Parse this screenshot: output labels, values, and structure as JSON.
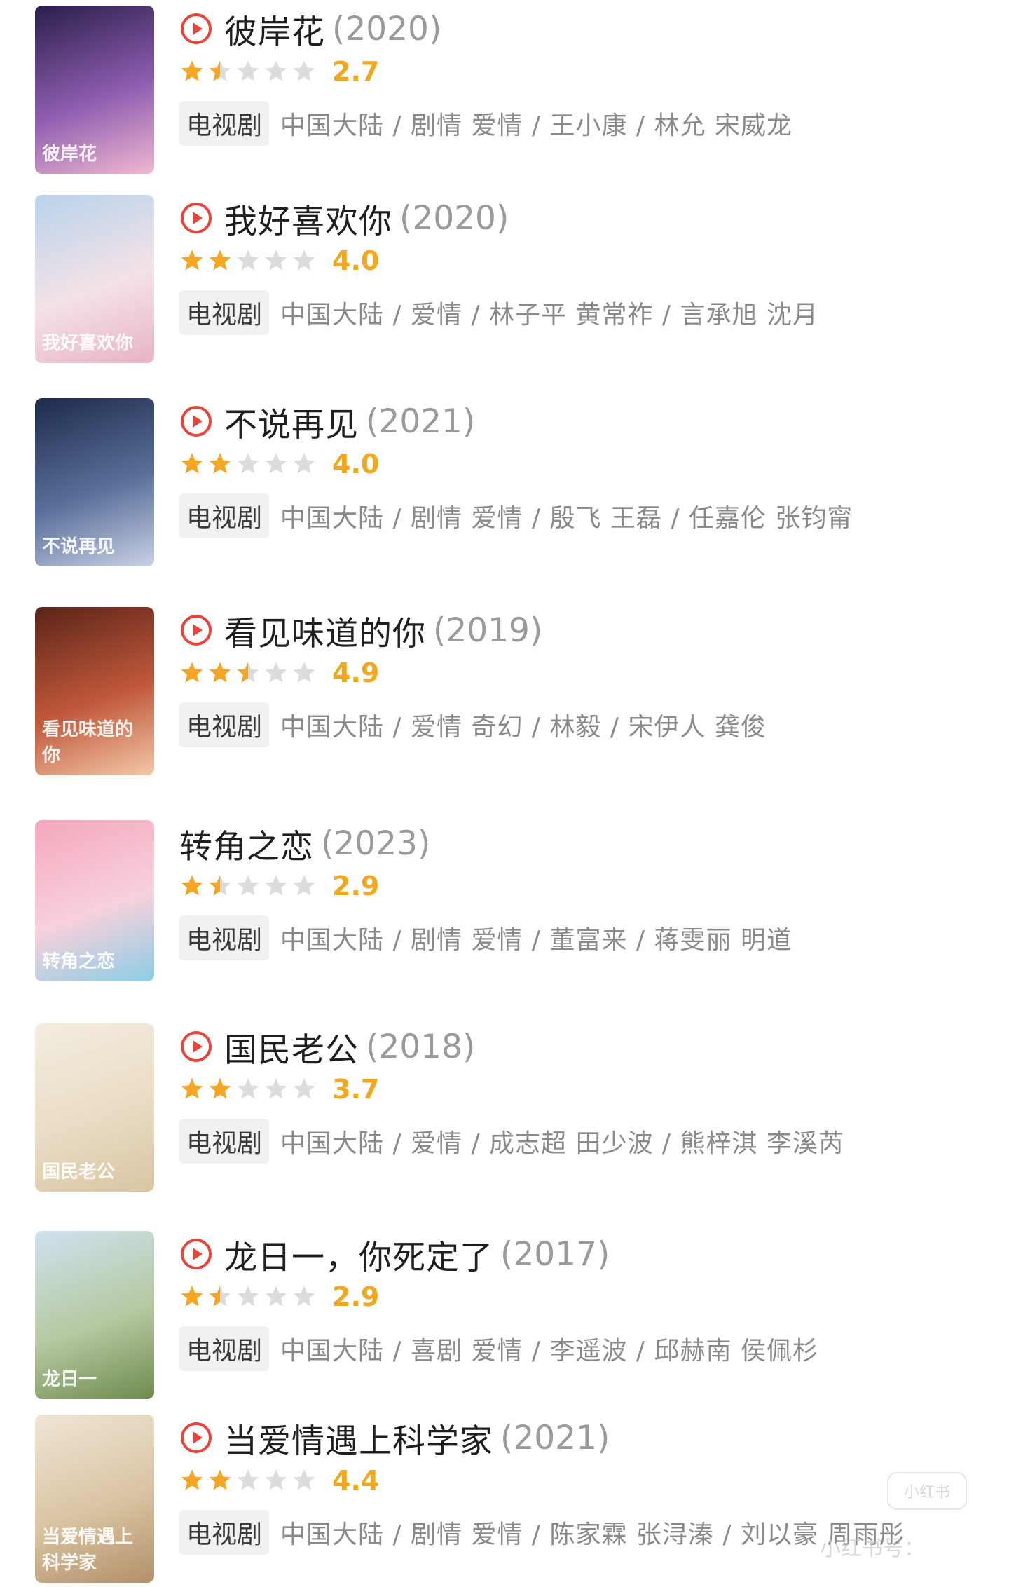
{
  "colors": {
    "play_icon": "#e8443a",
    "star_filled": "#f5a623",
    "star_empty": "#dcdcdc",
    "score": "#f0a81f",
    "title": "#1f1f1f",
    "year": "#9a9a9a",
    "meta": "#8a8a8a",
    "tag_bg": "#f1f1f1"
  },
  "items": [
    {
      "title": "彼岸花",
      "year": "(2020)",
      "has_play_icon": true,
      "stars": 1.5,
      "score": "2.7",
      "tag": "电视剧",
      "meta": "中国大陆 / 剧情 爱情 / 王小康 / 林允 宋威龙",
      "poster_caption": "彼岸花",
      "poster_colors": [
        "#2a1f4a",
        "#8e5db0",
        "#f0b8d0"
      ]
    },
    {
      "title": "我好喜欢你",
      "year": "(2020)",
      "has_play_icon": true,
      "stars": 2,
      "score": "4.0",
      "tag": "电视剧",
      "meta": "中国大陆 / 爱情 / 林子平 黄常祚 / 言承旭 沈月",
      "poster_caption": "我好喜欢你",
      "poster_colors": [
        "#b8d3ec",
        "#f3e2e6",
        "#e8b3c3"
      ]
    },
    {
      "title": "不说再见",
      "year": "(2021)",
      "has_play_icon": true,
      "stars": 2,
      "score": "4.0",
      "tag": "电视剧",
      "meta": "中国大陆 / 剧情 爱情 / 殷飞 王磊 / 任嘉伦 张钧甯",
      "poster_caption": "不说再见",
      "poster_colors": [
        "#1d2b4a",
        "#5a6f9a",
        "#c9d2e6"
      ]
    },
    {
      "title": "看见味道的你",
      "year": "(2019)",
      "has_play_icon": true,
      "stars": 2.5,
      "score": "4.9",
      "tag": "电视剧",
      "meta": "中国大陆 / 爱情 奇幻 / 林毅 / 宋伊人 龚俊",
      "poster_caption": "看见味道的你",
      "poster_colors": [
        "#5a2418",
        "#c0583a",
        "#f3c8a8"
      ]
    },
    {
      "title": "转角之恋",
      "year": "(2023)",
      "has_play_icon": false,
      "stars": 1.5,
      "score": "2.9",
      "tag": "电视剧",
      "meta": "中国大陆 / 剧情 爱情 / 董富来 / 蒋雯丽 明道",
      "poster_caption": "转角之恋",
      "poster_colors": [
        "#f4a7bd",
        "#f7d1db",
        "#8ccde6"
      ]
    },
    {
      "title": "国民老公",
      "year": "(2018)",
      "has_play_icon": true,
      "stars": 2,
      "score": "3.7",
      "tag": "电视剧",
      "meta": "中国大陆 / 爱情 / 成志超 田少波 / 熊梓淇 李溪芮",
      "poster_caption": "国民老公",
      "poster_colors": [
        "#f4ede0",
        "#e9dcc4",
        "#d8c6a2"
      ]
    },
    {
      "title": "龙日一，你死定了",
      "year": "(2017)",
      "has_play_icon": true,
      "stars": 1.5,
      "score": "2.9",
      "tag": "电视剧",
      "meta": "中国大陆 / 喜剧 爱情 / 李遥波 / 邱赫南 侯佩杉",
      "poster_caption": "龙日一",
      "poster_colors": [
        "#cfe1ef",
        "#b5c9a0",
        "#6f8a4d"
      ]
    },
    {
      "title": "当爱情遇上科学家",
      "year": "(2021)",
      "has_play_icon": true,
      "stars": 2,
      "score": "4.4",
      "tag": "电视剧",
      "meta": "中国大陆 / 剧情 爱情 / 陈家霖 张浔溱 / 刘以豪 周雨彤",
      "poster_caption": "当爱情遇上科学家",
      "poster_colors": [
        "#efe6d6",
        "#d9c4a2",
        "#b39069"
      ]
    }
  ],
  "watermark": {
    "text": "小红书号：",
    "badge": "小红书"
  }
}
